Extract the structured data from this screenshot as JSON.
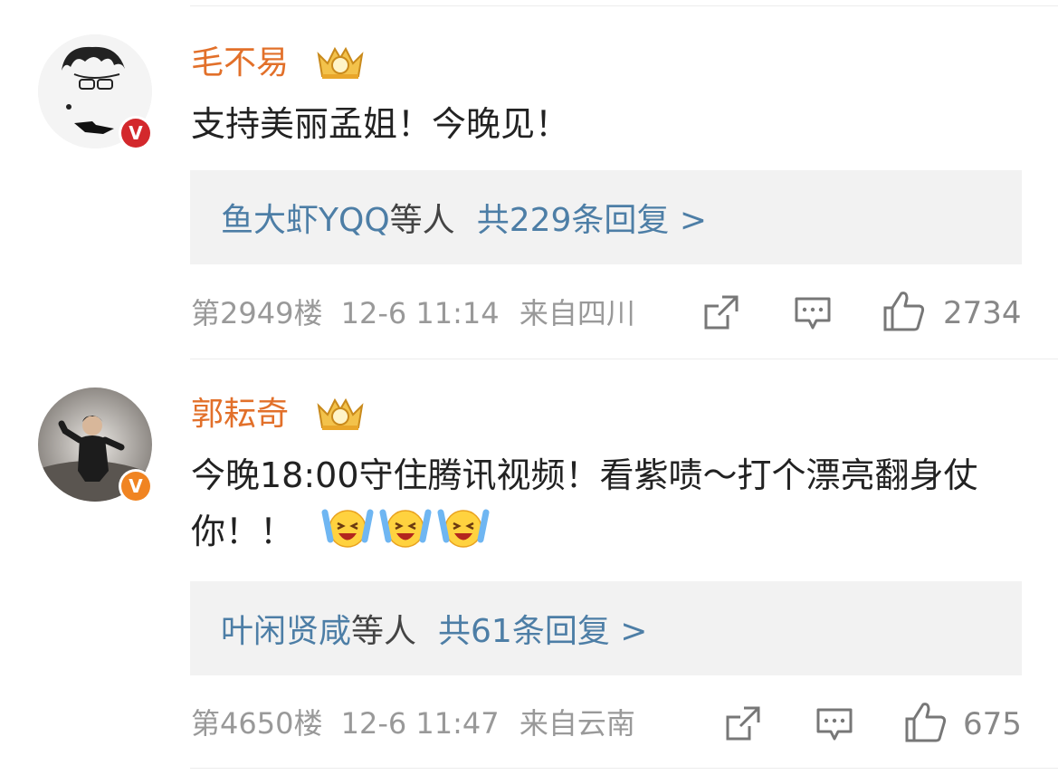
{
  "comments": [
    {
      "username": "毛不易",
      "text": "支持美丽孟姐！今晚见！",
      "reply_user": "鱼大虾YQQ",
      "reply_mid": "等人",
      "reply_count": "共229条回复 >",
      "floor": "第2949楼",
      "time": "12-6 11:14",
      "location": "来自四川",
      "likes": "2734",
      "badge_color": "#d3282c"
    },
    {
      "username": "郭耘奇",
      "text": "今晚18:00守住腾讯视频！看紫啧～打个漂亮翻身仗你！！",
      "reply_user": "叶闲贤咸",
      "reply_mid": "等人",
      "reply_count": "共61条回复 >",
      "floor": "第4650楼",
      "time": "12-6 11:47",
      "location": "来自云南",
      "likes": "675",
      "badge_color": "#f08422"
    }
  ],
  "icons": {
    "verified": "verified-v-icon",
    "crown": "crown-icon",
    "share": "share-icon",
    "comment": "comment-icon",
    "like": "thumbs-up-icon",
    "emoji": "laughing-tears-emoji"
  },
  "colors": {
    "username": "#e2702a",
    "reply_link": "#4d7ea6",
    "meta": "#999999"
  }
}
